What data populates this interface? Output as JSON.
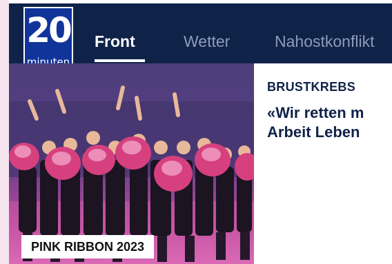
{
  "header": {
    "logo": {
      "number": "20",
      "word": "minuten"
    },
    "nav": [
      {
        "label": "Front",
        "active": true
      },
      {
        "label": "Wetter",
        "active": false
      },
      {
        "label": "Nahostkonflikt",
        "active": false
      }
    ]
  },
  "teaser": {
    "image_caption": "PINK RIBBON 2023",
    "kicker": "BRUSTKREBS",
    "headline_line1": "«Wir retten m",
    "headline_line2": "Arbeit Leben"
  },
  "colors": {
    "header_bg": "#0f2349",
    "logo_bg": "#11349b",
    "nav_inactive": "#8d9bb8",
    "headline": "#0f2349",
    "page_bg": "#f6e4ee"
  }
}
